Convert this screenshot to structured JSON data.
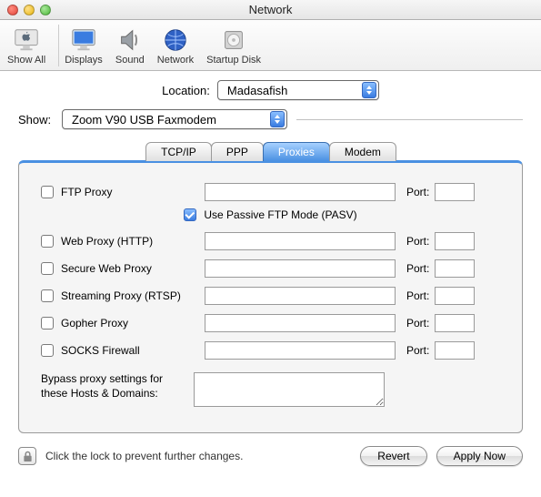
{
  "window": {
    "title": "Network"
  },
  "toolbar": {
    "show_all": "Show All",
    "displays": "Displays",
    "sound": "Sound",
    "network": "Network",
    "startup_disk": "Startup Disk"
  },
  "location": {
    "label": "Location:",
    "value": "Madasafish"
  },
  "show": {
    "label": "Show:",
    "value": "Zoom V90 USB Faxmodem"
  },
  "tabs": {
    "tcpip": "TCP/IP",
    "ppp": "PPP",
    "proxies": "Proxies",
    "modem": "Modem"
  },
  "proxies": {
    "port_label": "Port:",
    "ftp": {
      "label": "FTP Proxy",
      "host": "",
      "port": ""
    },
    "pasv": {
      "label": "Use Passive FTP Mode (PASV)",
      "checked": true
    },
    "http": {
      "label": "Web Proxy (HTTP)",
      "host": "",
      "port": ""
    },
    "https": {
      "label": "Secure Web Proxy",
      "host": "",
      "port": ""
    },
    "rtsp": {
      "label": "Streaming Proxy (RTSP)",
      "host": "",
      "port": ""
    },
    "gopher": {
      "label": "Gopher Proxy",
      "host": "",
      "port": ""
    },
    "socks": {
      "label": "SOCKS Firewall",
      "host": "",
      "port": ""
    },
    "bypass": {
      "label": "Bypass proxy settings for these Hosts & Domains:",
      "value": ""
    }
  },
  "footer": {
    "lock_text": "Click the lock to prevent further changes.",
    "revert": "Revert",
    "apply": "Apply Now"
  }
}
